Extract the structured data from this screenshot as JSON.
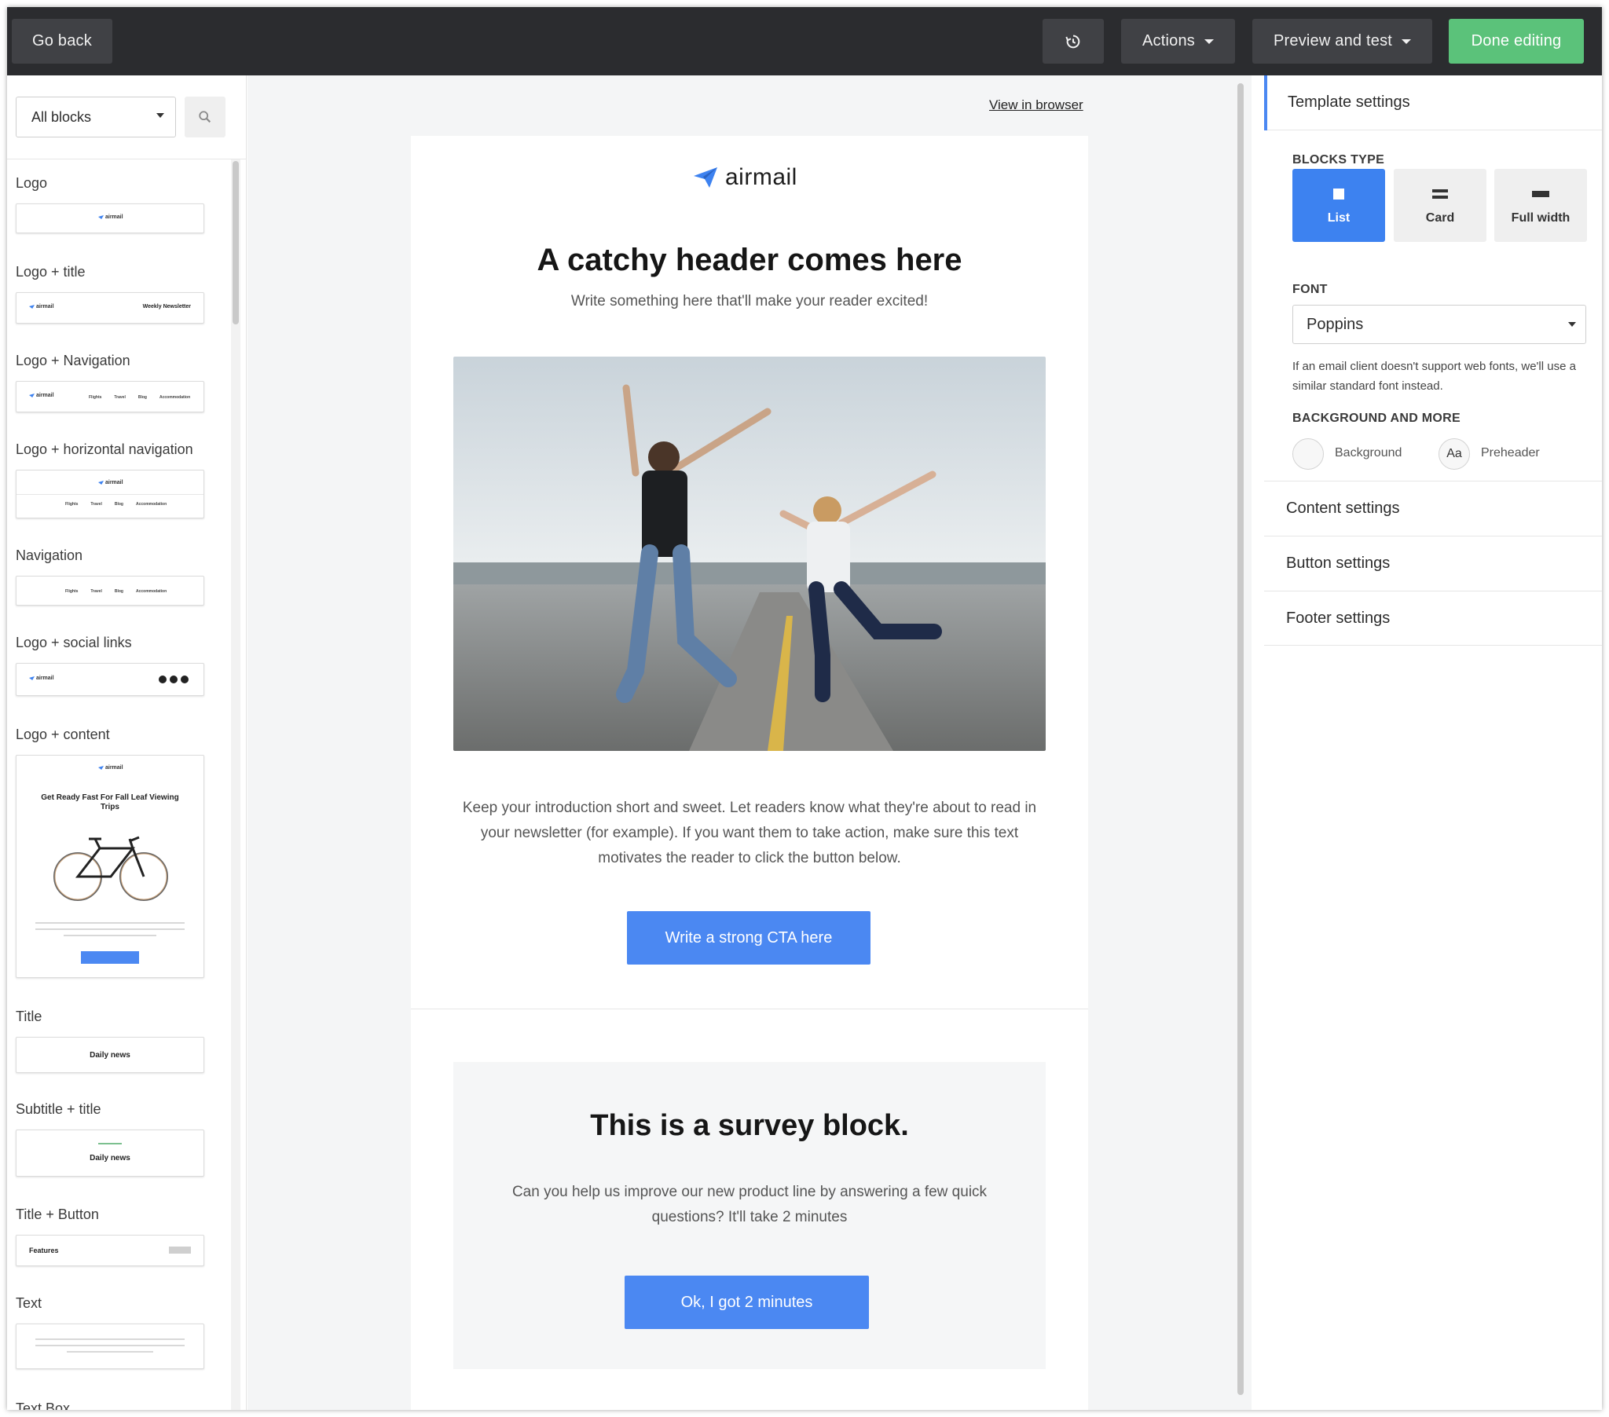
{
  "topbar": {
    "go_back": "Go back",
    "history_icon": "history-icon",
    "actions": "Actions",
    "preview": "Preview and test",
    "done": "Done editing"
  },
  "sidebar": {
    "filter_value": "All blocks",
    "search_icon": "search-icon",
    "blocks": [
      {
        "label": "Logo"
      },
      {
        "label": "Logo + title",
        "title": "Weekly Newsletter"
      },
      {
        "label": "Logo + Navigation"
      },
      {
        "label": "Logo + horizontal navigation"
      },
      {
        "label": "Navigation"
      },
      {
        "label": "Logo + social links"
      },
      {
        "label": "Logo + content",
        "title": "Get Ready Fast For Fall Leaf Viewing Trips"
      },
      {
        "label": "Title",
        "title": "Daily news"
      },
      {
        "label": "Subtitle + title",
        "title": "Daily news"
      },
      {
        "label": "Title + Button",
        "title": "Features"
      },
      {
        "label": "Text"
      },
      {
        "label": "Text Box"
      }
    ],
    "mini_logo": "airmail",
    "mini_nav": [
      "Flights",
      "Travel",
      "Blog",
      "Accommodation"
    ]
  },
  "canvas": {
    "view_in_browser": "View in browser",
    "logo_text": "airmail",
    "header": "A catchy header comes here",
    "subheader": "Write something here that'll make your reader excited!",
    "intro": "Keep your introduction short and sweet. Let readers know what they're about to read in your newsletter (for example). If you want them to take action, make sure this text motivates the reader to click the button below.",
    "cta": "Write a strong CTA here",
    "survey_title": "This is a survey block.",
    "survey_text": "Can you help us improve our new product line by answering a few quick questions? It'll take 2 minutes",
    "survey_button": "Ok, I got 2 minutes"
  },
  "panel": {
    "tab": "Template settings",
    "blocks_type_title": "BLOCKS TYPE",
    "types": [
      "List",
      "Card",
      "Full width"
    ],
    "font_title": "FONT",
    "font_value": "Poppins",
    "font_note": "If an email client doesn't support web fonts, we'll use a similar standard font instead.",
    "bg_title": "BACKGROUND AND MORE",
    "background": "Background",
    "preheader_glyph": "Aa",
    "preheader": "Preheader",
    "rows": [
      "Content settings",
      "Button settings",
      "Footer settings"
    ]
  },
  "colors": {
    "topbar": "#2b2c2f",
    "done_green": "#5bc27a",
    "accent_blue": "#4b88f2"
  }
}
